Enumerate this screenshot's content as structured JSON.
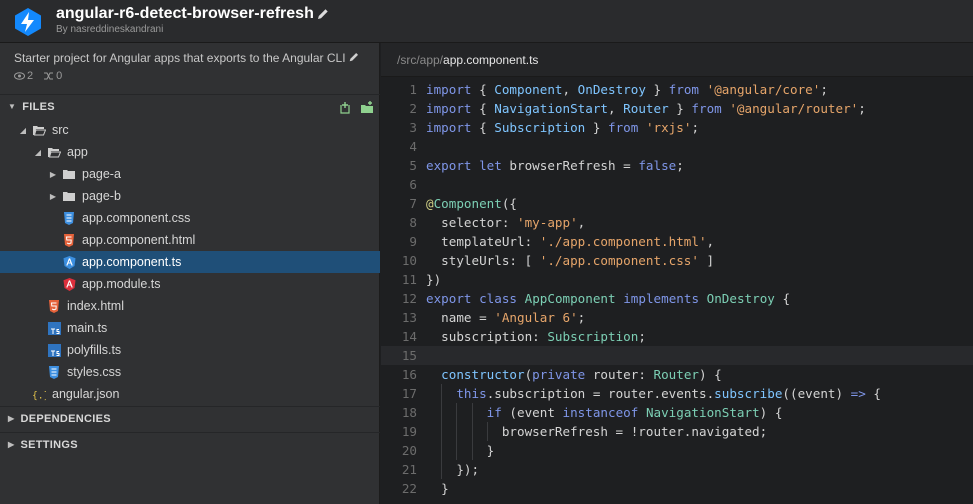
{
  "header": {
    "title": "angular-r6-detect-browser-refresh",
    "by": "By nasreddineskandrani"
  },
  "sidebar": {
    "description": "Starter project for Angular apps that exports to the Angular CLI",
    "stats": {
      "views": "2",
      "forks": "0"
    },
    "files_label": "FILES",
    "dependencies_label": "DEPENDENCIES",
    "settings_label": "SETTINGS",
    "tree": [
      {
        "label": "src",
        "depth": 0,
        "type": "folder-open",
        "expanded": true
      },
      {
        "label": "app",
        "depth": 1,
        "type": "folder-open",
        "expanded": true
      },
      {
        "label": "page-a",
        "depth": 2,
        "type": "folder",
        "expanded": false
      },
      {
        "label": "page-b",
        "depth": 2,
        "type": "folder",
        "expanded": false
      },
      {
        "label": "app.component.css",
        "depth": 2,
        "type": "css"
      },
      {
        "label": "app.component.html",
        "depth": 2,
        "type": "html"
      },
      {
        "label": "app.component.ts",
        "depth": 2,
        "type": "ng",
        "selected": true
      },
      {
        "label": "app.module.ts",
        "depth": 2,
        "type": "ng-red"
      },
      {
        "label": "index.html",
        "depth": 1,
        "type": "html"
      },
      {
        "label": "main.ts",
        "depth": 1,
        "type": "ts"
      },
      {
        "label": "polyfills.ts",
        "depth": 1,
        "type": "ts"
      },
      {
        "label": "styles.css",
        "depth": 1,
        "type": "css"
      },
      {
        "label": "angular.json",
        "depth": 0,
        "type": "json"
      }
    ]
  },
  "editor": {
    "breadcrumb_path": "/src/app/",
    "breadcrumb_file": "app.component.ts",
    "current_line": 15,
    "lines": [
      {
        "n": "1",
        "indent": 0,
        "tokens": [
          [
            "k",
            "import"
          ],
          [
            "p",
            " { "
          ],
          [
            "f",
            "Component"
          ],
          [
            "p",
            ", "
          ],
          [
            "f",
            "OnDestroy"
          ],
          [
            "p",
            " } "
          ],
          [
            "k",
            "from"
          ],
          [
            "p",
            " "
          ],
          [
            "s",
            "'@angular/core'"
          ],
          [
            "p",
            ";"
          ]
        ]
      },
      {
        "n": "2",
        "indent": 0,
        "tokens": [
          [
            "k",
            "import"
          ],
          [
            "p",
            " { "
          ],
          [
            "f",
            "NavigationStart"
          ],
          [
            "p",
            ", "
          ],
          [
            "f",
            "Router"
          ],
          [
            "p",
            " } "
          ],
          [
            "k",
            "from"
          ],
          [
            "p",
            " "
          ],
          [
            "s",
            "'@angular/router'"
          ],
          [
            "p",
            ";"
          ]
        ]
      },
      {
        "n": "3",
        "indent": 0,
        "tokens": [
          [
            "k",
            "import"
          ],
          [
            "p",
            " { "
          ],
          [
            "f",
            "Subscription"
          ],
          [
            "p",
            " } "
          ],
          [
            "k",
            "from"
          ],
          [
            "p",
            " "
          ],
          [
            "s",
            "'rxjs'"
          ],
          [
            "p",
            ";"
          ]
        ]
      },
      {
        "n": "4",
        "indent": 0,
        "tokens": []
      },
      {
        "n": "5",
        "indent": 0,
        "tokens": [
          [
            "k",
            "export"
          ],
          [
            "p",
            " "
          ],
          [
            "k",
            "let"
          ],
          [
            "p",
            " browserRefresh = "
          ],
          [
            "k",
            "false"
          ],
          [
            "p",
            ";"
          ]
        ]
      },
      {
        "n": "6",
        "indent": 0,
        "tokens": []
      },
      {
        "n": "7",
        "indent": 0,
        "tokens": [
          [
            "d",
            "@"
          ],
          [
            "t",
            "Component"
          ],
          [
            "p",
            "({"
          ]
        ]
      },
      {
        "n": "8",
        "indent": 1,
        "tokens": [
          [
            "p",
            "  selector: "
          ],
          [
            "s",
            "'my-app'"
          ],
          [
            "p",
            ","
          ]
        ]
      },
      {
        "n": "9",
        "indent": 1,
        "tokens": [
          [
            "p",
            "  templateUrl: "
          ],
          [
            "s",
            "'./app.component.html'"
          ],
          [
            "p",
            ","
          ]
        ]
      },
      {
        "n": "10",
        "indent": 1,
        "tokens": [
          [
            "p",
            "  styleUrls: [ "
          ],
          [
            "s",
            "'./app.component.css'"
          ],
          [
            "p",
            " ]"
          ]
        ]
      },
      {
        "n": "11",
        "indent": 0,
        "tokens": [
          [
            "p",
            "})"
          ]
        ]
      },
      {
        "n": "12",
        "indent": 0,
        "tokens": [
          [
            "k",
            "export"
          ],
          [
            "p",
            " "
          ],
          [
            "k",
            "class"
          ],
          [
            "p",
            " "
          ],
          [
            "t",
            "AppComponent"
          ],
          [
            "p",
            " "
          ],
          [
            "k",
            "implements"
          ],
          [
            "p",
            " "
          ],
          [
            "t",
            "OnDestroy"
          ],
          [
            "p",
            " {"
          ]
        ]
      },
      {
        "n": "13",
        "indent": 1,
        "tokens": [
          [
            "p",
            "  name = "
          ],
          [
            "s",
            "'Angular 6'"
          ],
          [
            "p",
            ";"
          ]
        ]
      },
      {
        "n": "14",
        "indent": 1,
        "tokens": [
          [
            "p",
            "  subscription: "
          ],
          [
            "t",
            "Subscription"
          ],
          [
            "p",
            ";"
          ]
        ]
      },
      {
        "n": "15",
        "indent": 1,
        "tokens": []
      },
      {
        "n": "16",
        "indent": 1,
        "tokens": [
          [
            "p",
            "  "
          ],
          [
            "f",
            "constructor"
          ],
          [
            "p",
            "("
          ],
          [
            "k",
            "private"
          ],
          [
            "p",
            " router: "
          ],
          [
            "t",
            "Router"
          ],
          [
            "p",
            ") {"
          ]
        ]
      },
      {
        "n": "17",
        "indent": 2,
        "tokens": [
          [
            "p",
            "    "
          ],
          [
            "k",
            "this"
          ],
          [
            "p",
            ".subscription = router.events."
          ],
          [
            "f",
            "subscribe"
          ],
          [
            "p",
            "((event) "
          ],
          [
            "k",
            "=>"
          ],
          [
            "p",
            " {"
          ]
        ]
      },
      {
        "n": "18",
        "indent": 4,
        "tokens": [
          [
            "p",
            "        "
          ],
          [
            "k",
            "if"
          ],
          [
            "p",
            " (event "
          ],
          [
            "k",
            "instanceof"
          ],
          [
            "p",
            " "
          ],
          [
            "t",
            "NavigationStart"
          ],
          [
            "p",
            ") {"
          ]
        ]
      },
      {
        "n": "19",
        "indent": 5,
        "tokens": [
          [
            "p",
            "          browserRefresh = !router.navigated;"
          ]
        ]
      },
      {
        "n": "20",
        "indent": 4,
        "tokens": [
          [
            "p",
            "        }"
          ]
        ]
      },
      {
        "n": "21",
        "indent": 2,
        "tokens": [
          [
            "p",
            "    });"
          ]
        ]
      },
      {
        "n": "22",
        "indent": 1,
        "tokens": [
          [
            "p",
            "  }"
          ]
        ]
      }
    ]
  }
}
